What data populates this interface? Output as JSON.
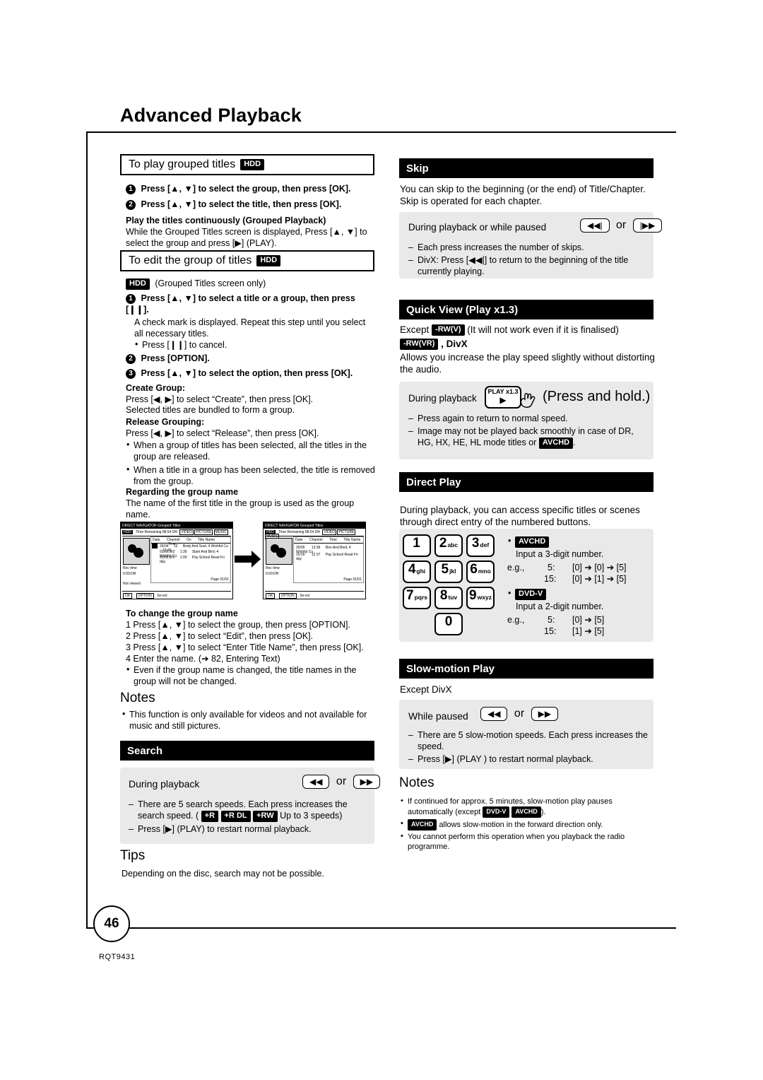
{
  "page": {
    "title": "Advanced Playback",
    "number": "46",
    "doc_code": "RQT9431"
  },
  "left": {
    "section1": {
      "heading": "To play grouped titles",
      "heading_tag": "HDD",
      "step1": "Press [▲, ▼] to select the group, then press [OK].",
      "step2": "Press [▲, ▼] to select the title, then press [OK].",
      "sub_heading": "Play the titles continuously (Grouped Playback)",
      "sub_body": "While the Grouped Titles screen is displayed, Press [▲, ▼] to select the group and press [▶] (PLAY)."
    },
    "section2": {
      "heading": "To edit the group of titles",
      "heading_tag": "HDD",
      "note_tag": "HDD",
      "note": "(Grouped Titles screen only)",
      "step1": "Press [▲, ▼] to select a title or a group, then press [❙❙].",
      "step1_body": "A check mark is displayed. Repeat this step until you select all necessary titles.",
      "step1_bullet": "Press [❙❙] to cancel.",
      "step2": "Press [OPTION].",
      "step3": "Press [▲, ▼] to select the option, then press [OK].",
      "create_heading": "Create Group:",
      "create_body1": "Press [◀, ▶] to select “Create”, then press [OK].",
      "create_body2": "Selected titles are bundled to form a group.",
      "release_heading": "Release Grouping:",
      "release_body": "Press [◀, ▶] to select “Release”, then press [OK].",
      "release_bullets": [
        "When a group of titles has been selected, all the titles in the group are released.",
        "When a title in a group has been selected, the title is removed from the group."
      ],
      "regarding_heading": "Regarding the group name",
      "regarding_body": "The name of the first title in the group is used as the group name.",
      "change_heading": "To change the group name",
      "change_steps": [
        "1 Press [▲, ▼] to select the group, then press [OPTION].",
        "2 Press [▲, ▼] to select “Edit”, then press [OK].",
        "3 Press [▲, ▼] to select “Enter Title Name”, then press [OK].",
        "4 Enter the name. (➔ 82, Entering Text)"
      ],
      "change_bullet": "Even if the group name is changed, the title names in the group will not be changed."
    },
    "notes": {
      "heading": "Notes",
      "items": [
        "This function is only available for videos and not available for music and still pictures."
      ]
    },
    "search": {
      "heading": "Search",
      "during": "During playback",
      "key_rew": "◀◀",
      "or": "or",
      "key_ff": "▶▶",
      "line1a": "There are 5 search speeds. Each press increases the",
      "line1b": "search speed. (",
      "tags": [
        "+R",
        "+R DL",
        "+RW"
      ],
      "line1c": "Up to 3 speeds)",
      "line2": "Press [▶] (PLAY) to restart normal playback."
    },
    "tips": {
      "heading": "Tips",
      "body": "Depending on the disc, search may not be possible."
    },
    "figure": {
      "left_title": "DIRECT NAVIGATOR   Grouped Titles",
      "right_title": "DIRECT NAVIGATOR   Grouped Titles",
      "hdd_label": "HDD",
      "time_remaining": "Time Remaining   88:54 DR",
      "media_tags": [
        "VIDEO",
        "PICTURE",
        "MUSIC"
      ],
      "columns": [
        "Date",
        "Channel",
        "On",
        "Title Name",
        "Time"
      ],
      "rows": [
        [
          "26/04",
          "12",
          "Body And Soul; 4 Wishful Cu",
          "72:45"
        ],
        [
          "91/06.W2",
          "1:30",
          "Slam And Bird; 4 Wishful Cu",
          ""
        ],
        [
          "91/06.W1",
          "1:00",
          "Pay School Read Fri day",
          ""
        ]
      ],
      "rec_time": "Rec time",
      "size": "0:00:DR",
      "not_viewed": "Not viewed",
      "page_label": "Page 01/01",
      "footer_keys": [
        "OK",
        "OPTION",
        "Se-ect"
      ],
      "right_columns": [
        "Date",
        "Channel",
        "Time",
        "Title Name"
      ],
      "right_rows": [
        [
          "25/05",
          "13:36",
          "Bon And Bind; 4 Wishful Cu"
        ],
        [
          "25:00",
          "12:37",
          "Pay School Read Fri day"
        ]
      ]
    }
  },
  "right": {
    "skip": {
      "heading": "Skip",
      "body": "You can skip to the beginning (or the end) of Title/Chapter. Skip is operated for each chapter.",
      "during": "During playback or while paused",
      "key_prev": "◀◀|",
      "or": "or",
      "key_next": "|▶▶",
      "items": [
        "Each press increases the number of skips.",
        "DivX: Press [◀◀|] to return to the beginning of the title currently playing."
      ]
    },
    "quickview": {
      "heading": "Quick View (Play x1.3)",
      "except_pre": "Except",
      "except_tag1": "-RW(V)",
      "except_post": "(It will not work even if it is finalised)",
      "except_tag2": "-RW(VR)",
      "except_divx": ", DivX",
      "body": "Allows you increase the play speed slightly without distorting the audio.",
      "during": "During playback",
      "key_label_top": "PLAY x1.3",
      "key_label_bottom": "▶",
      "press_hold": "(Press and hold.)",
      "items": [
        "Press again to return to normal speed.",
        "Image may not be played back smoothly in case of DR, HG, HX, HE, HL mode titles or"
      ],
      "item2_tag": "AVCHD",
      "item2_end": "."
    },
    "directplay": {
      "heading": "Direct Play",
      "body": "During playback, you can access specific titles or scenes through direct entry of the numbered buttons.",
      "keys": [
        {
          "n": "1",
          "s": ""
        },
        {
          "n": "2",
          "s": "abc"
        },
        {
          "n": "3",
          "s": "def"
        },
        {
          "n": "4",
          "s": "ghi"
        },
        {
          "n": "5",
          "s": "jkl"
        },
        {
          "n": "6",
          "s": "mno"
        },
        {
          "n": "7",
          "s": "pqrs"
        },
        {
          "n": "8",
          "s": "tuv"
        },
        {
          "n": "9",
          "s": "wxyz"
        },
        {
          "n": "0",
          "s": ""
        }
      ],
      "avchd_tag": "AVCHD",
      "avchd_line": "Input a 3-digit number.",
      "avchd_eg": "e.g.,",
      "avchd_rows": [
        {
          "label": "5:",
          "val": "[0] ➔ [0] ➔ [5]"
        },
        {
          "label": "15:",
          "val": "[0] ➔ [1] ➔ [5]"
        }
      ],
      "dvd_tag": "DVD-V",
      "dvd_line": "Input a 2-digit number.",
      "dvd_eg": "e.g.,",
      "dvd_rows": [
        {
          "label": "5:",
          "val": "[0] ➔ [5]"
        },
        {
          "label": "15:",
          "val": "[1] ➔ [5]"
        }
      ]
    },
    "slowmotion": {
      "heading": "Slow-motion Play",
      "except": "Except DivX",
      "while_paused": "While paused",
      "key_rew": "◀◀",
      "or": "or",
      "key_ff": "▶▶",
      "items": [
        "There are 5 slow-motion speeds. Each press increases the speed.",
        "Press [▶] (PLAY ) to restart normal playback."
      ]
    },
    "notes": {
      "heading": "Notes",
      "item1_a": "If continued for approx. 5 minutes, slow-motion play pauses automatically (except",
      "item1_tag1": "DVD-V",
      "item1_tag2": "AVCHD",
      "item1_b": ").",
      "item2_tag": "AVCHD",
      "item2": "allows slow-motion in the forward direction only.",
      "item3": "You cannot perform this operation when you playback the radio programme."
    }
  }
}
